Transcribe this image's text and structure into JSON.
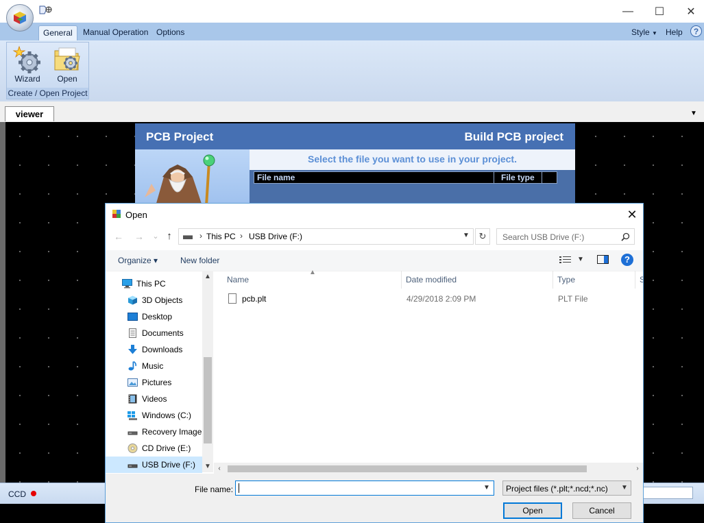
{
  "app": {
    "ribbon_tabs": [
      "General",
      "Manual Operation",
      "Options"
    ],
    "right_menu": {
      "style": "Style",
      "help": "Help"
    },
    "window_controls": {
      "minimize": "—",
      "maximize": "☐",
      "close": "✕"
    },
    "ribbon_group": {
      "wizard_label": "Wizard",
      "open_label": "Open",
      "group_label": "Create / Open Project"
    },
    "viewer_tab": "viewer",
    "status": {
      "text": "CCD",
      "dot_color": "#e60000"
    }
  },
  "pcb_panel": {
    "title": "PCB Project",
    "subtitle": "Build PCB project",
    "instruction": "Select the file you want to use in your project.",
    "columns": [
      "File name",
      "File type"
    ]
  },
  "dialog": {
    "title": "Open",
    "close": "✕",
    "nav": {
      "back": "←",
      "forward": "→",
      "recent": "⌄",
      "up": "↑"
    },
    "address": {
      "root": "This PC",
      "current": "USB Drive (F:)",
      "separator": "›"
    },
    "search_placeholder": "Search USB Drive (F:)",
    "toolbar": {
      "organize": "Organize ▾",
      "new_folder": "New folder",
      "help": "?"
    },
    "nav_items": [
      {
        "label": "This PC",
        "icon": "computer-icon"
      },
      {
        "label": "3D Objects",
        "icon": "cube-icon"
      },
      {
        "label": "Desktop",
        "icon": "desktop-icon"
      },
      {
        "label": "Documents",
        "icon": "documents-icon"
      },
      {
        "label": "Downloads",
        "icon": "download-arrow-icon"
      },
      {
        "label": "Music",
        "icon": "music-note-icon"
      },
      {
        "label": "Pictures",
        "icon": "pictures-icon"
      },
      {
        "label": "Videos",
        "icon": "film-icon"
      },
      {
        "label": "Windows (C:)",
        "icon": "windows-drive-icon"
      },
      {
        "label": "Recovery Image",
        "icon": "drive-icon"
      },
      {
        "label": "CD Drive (E:)",
        "icon": "cd-icon"
      },
      {
        "label": "USB Drive (F:)",
        "icon": "usb-drive-icon"
      }
    ],
    "columns": {
      "name": "Name",
      "date": "Date modified",
      "type": "Type",
      "size": "S"
    },
    "files": [
      {
        "name": "pcb.plt",
        "date": "4/29/2018 2:09 PM",
        "type": "PLT File"
      }
    ],
    "file_name_label": "File name:",
    "file_name_value": "",
    "filter": "Project files (*.plt;*.ncd;*.nc)",
    "buttons": {
      "open": "Open",
      "cancel": "Cancel"
    },
    "accent_color": "#0078d7",
    "selection_color": "#cce8ff"
  }
}
